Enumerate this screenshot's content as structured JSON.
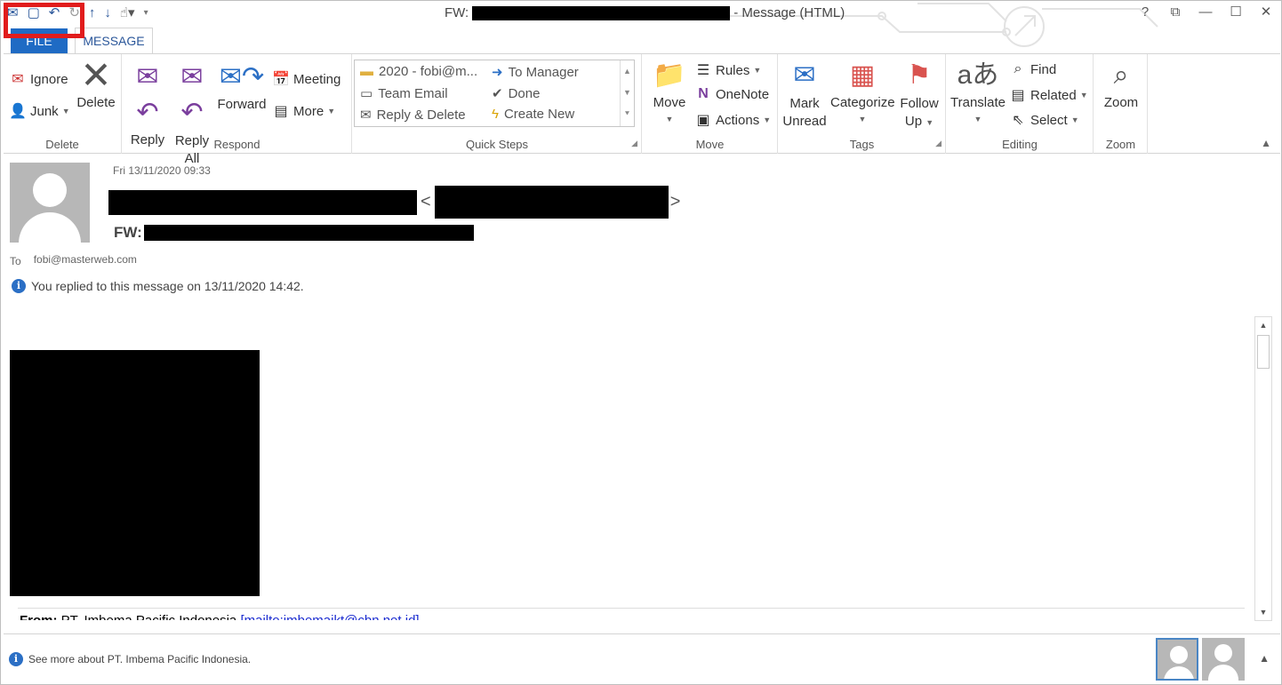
{
  "window": {
    "title_prefix": "FW:",
    "title_suffix": "- Message (HTML)",
    "controls": [
      "?",
      "⧉",
      "—",
      "☐",
      "✕"
    ]
  },
  "qat": {
    "icons": [
      "mail-icon",
      "save-icon",
      "undo-icon",
      "redo-icon",
      "up-arrow-icon",
      "down-arrow-icon",
      "touch-mode-icon",
      "customize-icon"
    ]
  },
  "tabs": {
    "file": "FILE",
    "message": "MESSAGE"
  },
  "ribbon": {
    "delete_group": {
      "label": "Delete",
      "ignore": "Ignore",
      "junk": "Junk",
      "delete": "Delete"
    },
    "respond_group": {
      "label": "Respond",
      "reply": "Reply",
      "reply_all_1": "Reply",
      "reply_all_2": "All",
      "forward": "Forward",
      "meeting": "Meeting",
      "more": "More"
    },
    "quick_steps": {
      "label": "Quick Steps",
      "items": [
        "2020 - fobi@m...",
        "Team Email",
        "Reply & Delete",
        "To Manager",
        "Done",
        "Create New"
      ]
    },
    "move_group": {
      "label": "Move",
      "move": "Move",
      "rules": "Rules",
      "onenote": "OneNote",
      "actions": "Actions"
    },
    "tags_group": {
      "label": "Tags",
      "mark_1": "Mark",
      "mark_2": "Unread",
      "categorize": "Categorize",
      "follow_1": "Follow",
      "follow_2": "Up"
    },
    "editing_group": {
      "label": "Editing",
      "translate": "Translate",
      "find": "Find",
      "related": "Related",
      "select": "Select"
    },
    "zoom_group": {
      "label": "Zoom",
      "zoom": "Zoom"
    }
  },
  "message": {
    "date": "Fri 13/11/2020 09:33",
    "subject_prefix": "FW:",
    "to_label": "To",
    "to_address": "fobi@masterweb.com",
    "replied_notice": "You replied to this message on 13/11/2020 14:42.",
    "from_label": "From:",
    "from_name": "PT. Imbema Pacific Indonesia",
    "from_link": "[mailto:imbemaikt@cbn.net.id]"
  },
  "people_pane": {
    "notice": "See more about PT. Imbema Pacific Indonesia."
  },
  "colors": {
    "accent": "#2b579a",
    "file_tab": "#1f6bc4",
    "highlight": "#e11c1c"
  }
}
